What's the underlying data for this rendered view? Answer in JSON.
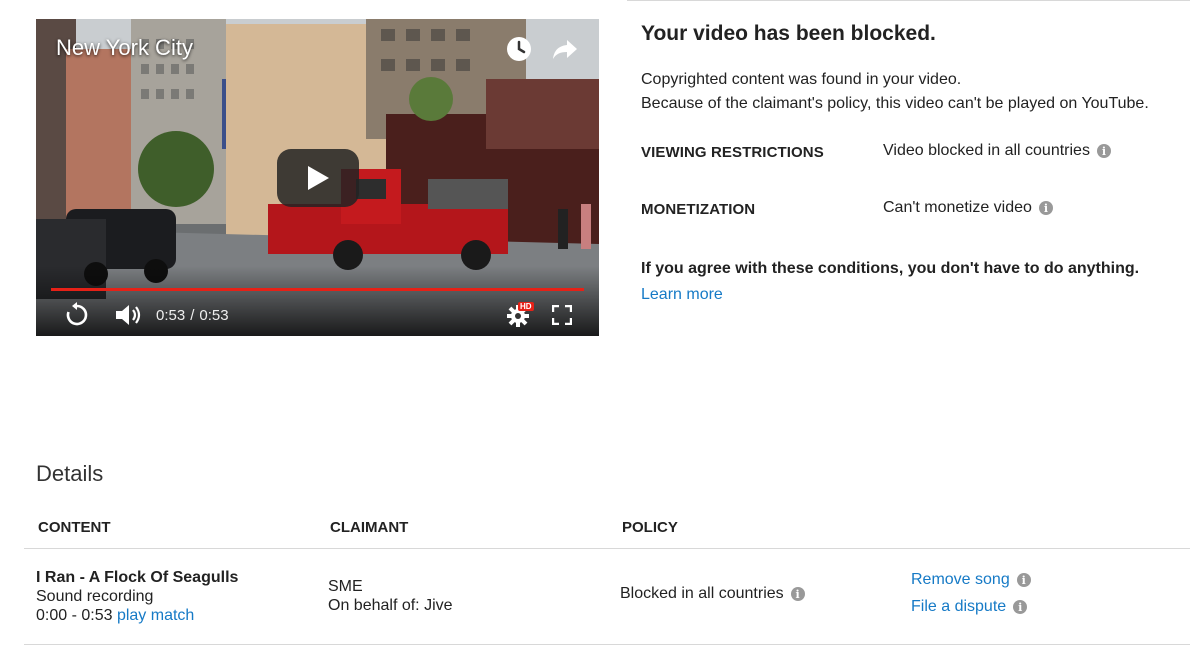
{
  "video": {
    "title": "New York City",
    "current_time": "0:53",
    "time_separator": "/",
    "duration": "0:53",
    "progress": 1.0,
    "hd_badge": "HD",
    "icons": {
      "watch_later": "clock-icon",
      "share": "share-arrow-icon",
      "play": "play-icon",
      "replay": "replay-icon",
      "volume": "volume-icon",
      "settings": "gear-icon",
      "fullscreen": "fullscreen-icon"
    }
  },
  "status": {
    "heading": "Your video has been blocked.",
    "line1": "Copyrighted content was found in your video.",
    "line2": "Because of the claimant's policy, this video can't be played on YouTube.",
    "viewing_label": "VIEWING RESTRICTIONS",
    "viewing_value": "Video blocked in all countries",
    "monetization_label": "MONETIZATION",
    "monetization_value": "Can't monetize video",
    "agree_text": "If you agree with these conditions, you don't have to do anything.",
    "learn_more": "Learn more"
  },
  "details": {
    "title": "Details",
    "columns": {
      "content": "CONTENT",
      "claimant": "CLAIMANT",
      "policy": "POLICY"
    },
    "rows": [
      {
        "content_title": "I Ran - A Flock Of Seagulls",
        "content_type": "Sound recording",
        "range": "0:00 - 0:53",
        "play_match": "play match",
        "claimant": "SME",
        "on_behalf": "On behalf of: Jive",
        "policy": "Blocked in all countries",
        "remove_song": "Remove song",
        "file_dispute": "File a dispute"
      }
    ]
  },
  "colors": {
    "link": "#167ac6",
    "progress": "#e62117",
    "info_icon": "#999999"
  }
}
